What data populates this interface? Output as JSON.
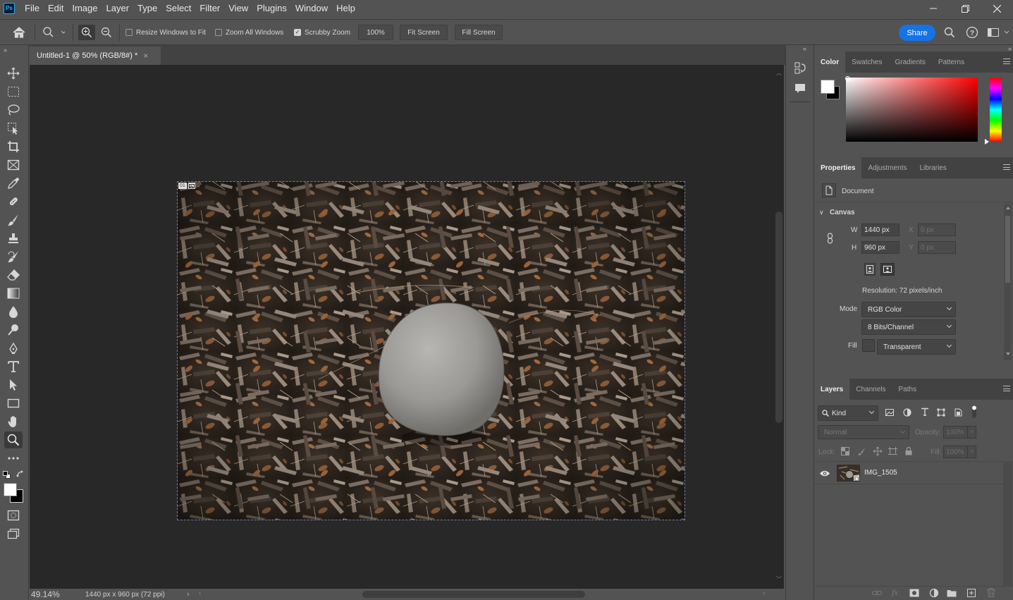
{
  "app": {
    "logo_text": "Ps"
  },
  "menu": [
    "File",
    "Edit",
    "Image",
    "Layer",
    "Type",
    "Select",
    "Filter",
    "View",
    "Plugins",
    "Window",
    "Help"
  ],
  "options": {
    "resize_windows_label": "Resize Windows to Fit",
    "resize_windows_checked": false,
    "zoom_all_label": "Zoom All Windows",
    "zoom_all_checked": false,
    "scrubby_zoom_label": "Scrubby Zoom",
    "scrubby_zoom_checked": true,
    "zoom_value": "100%",
    "fit_screen_label": "Fit Screen",
    "fill_screen_label": "Fill Screen",
    "share_label": "Share"
  },
  "document": {
    "tab_title": "Untitled-1 @ 50% (RGB/8#) *",
    "close_glyph": "×",
    "artboard_badge": "01"
  },
  "status": {
    "zoom": "49.14%",
    "info": "1440 px x 960 px (72 ppi)"
  },
  "color_panel": {
    "tabs": [
      "Color",
      "Swatches",
      "Gradients",
      "Patterns"
    ],
    "active_tab": "Color",
    "hue_color": "#ff0000",
    "foreground": "#ffffff",
    "background": "#000000"
  },
  "properties_panel": {
    "tabs": [
      "Properties",
      "Adjustments",
      "Libraries"
    ],
    "active_tab": "Properties",
    "type_label": "Document",
    "section_title": "Canvas",
    "w_label": "W",
    "w_value": "1440 px",
    "h_label": "H",
    "h_value": "960 px",
    "x_label": "X",
    "x_value": "0 px",
    "y_label": "Y",
    "y_value": "0 px",
    "resolution": "Resolution: 72 pixels/inch",
    "mode_label": "Mode",
    "mode_value": "RGB Color",
    "bits_value": "8 Bits/Channel",
    "fill_label": "Fill",
    "fill_value": "Transparent"
  },
  "layers_panel": {
    "tabs": [
      "Layers",
      "Channels",
      "Paths"
    ],
    "active_tab": "Layers",
    "filter_kind": "Kind",
    "blend_mode": "Normal",
    "opacity_label": "Opacity:",
    "opacity_value": "100%",
    "lock_label": "Lock:",
    "fill_label": "Fill:",
    "fill_value": "100%",
    "layers": [
      {
        "name": "IMG_1505",
        "visible": true
      }
    ]
  }
}
